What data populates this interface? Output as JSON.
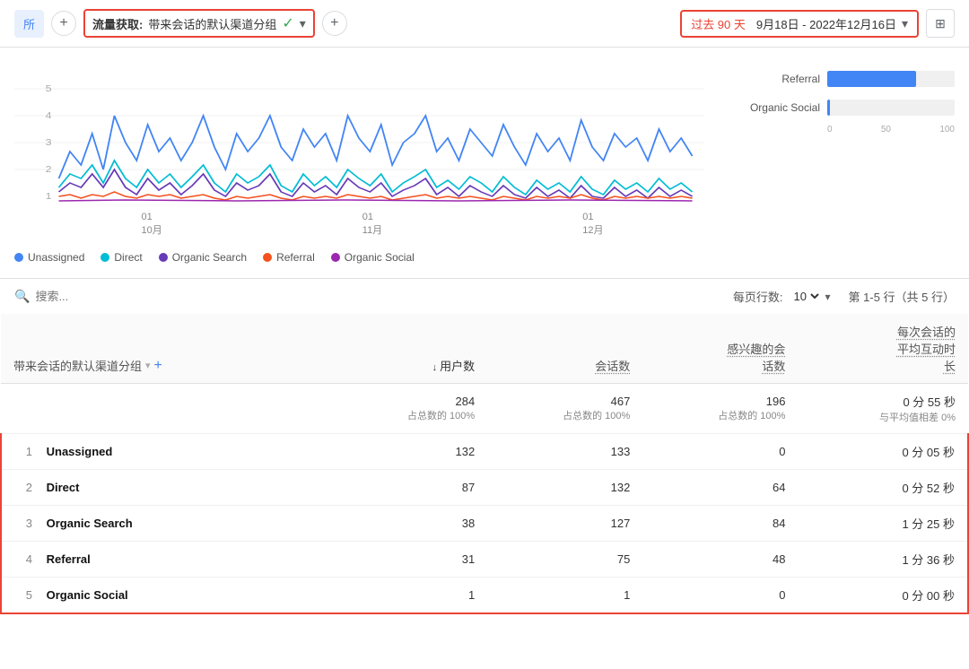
{
  "toolbar": {
    "left_btn_label": "所",
    "plus_btn_label": "+",
    "report_title_prefix": "流量获取:",
    "report_title_value": "带来会话的默认渠道分组",
    "date_preset": "过去 90 天",
    "date_range": "9月18日 - 2022年12月16日",
    "date_dropdown": "▾",
    "plus2_label": "+"
  },
  "legend": {
    "items": [
      {
        "label": "Unassigned",
        "color": "#4285f4"
      },
      {
        "label": "Direct",
        "color": "#00bcd4"
      },
      {
        "label": "Organic Search",
        "color": "#673ab7"
      },
      {
        "label": "Referral",
        "color": "#f4511e"
      },
      {
        "label": "Organic Social",
        "color": "#9c27b0"
      }
    ]
  },
  "bar_chart": {
    "items": [
      {
        "label": "Referral",
        "value": 70,
        "max": 100,
        "color": "#f4511e"
      },
      {
        "label": "Organic Social",
        "value": 2,
        "max": 100,
        "color": "#9c27b0"
      }
    ],
    "axis": [
      "0",
      "50",
      "100"
    ]
  },
  "x_labels": [
    "01\n10月",
    "01\n11月",
    "01\n12月"
  ],
  "table_controls": {
    "search_placeholder": "搜索...",
    "rows_per_page_label": "每页行数:",
    "rows_value": "10",
    "pagination_label": "第 1-5 行（共 5 行）"
  },
  "table": {
    "dim_col_header": "带来会话的默认渠道分组",
    "columns": [
      {
        "label": "用户数",
        "sort": true
      },
      {
        "label": "会话数",
        "sort": false,
        "underline": true
      },
      {
        "label": "感兴趣的会\n话数",
        "sort": false,
        "underline": true
      },
      {
        "label": "每次会话的\n平均互动时\n长",
        "sort": false,
        "underline": true
      }
    ],
    "total_row": {
      "users": "284",
      "users_sub": "占总数的 100%",
      "sessions": "467",
      "sessions_sub": "占总数的 100%",
      "engaged": "196",
      "engaged_sub": "占总数的 100%",
      "avg_time": "0 分 55 秒",
      "avg_time_sub": "与平均值相差 0%"
    },
    "rows": [
      {
        "index": 1,
        "name": "Unassigned",
        "users": "132",
        "sessions": "133",
        "engaged": "0",
        "avg_time": "0 分 05 秒"
      },
      {
        "index": 2,
        "name": "Direct",
        "users": "87",
        "sessions": "132",
        "engaged": "64",
        "avg_time": "0 分 52 秒"
      },
      {
        "index": 3,
        "name": "Organic Search",
        "users": "38",
        "sessions": "127",
        "engaged": "84",
        "avg_time": "1 分 25 秒"
      },
      {
        "index": 4,
        "name": "Referral",
        "users": "31",
        "sessions": "75",
        "engaged": "48",
        "avg_time": "1 分 36 秒"
      },
      {
        "index": 5,
        "name": "Organic Social",
        "users": "1",
        "sessions": "1",
        "engaged": "0",
        "avg_time": "0 分 00 秒"
      }
    ]
  }
}
